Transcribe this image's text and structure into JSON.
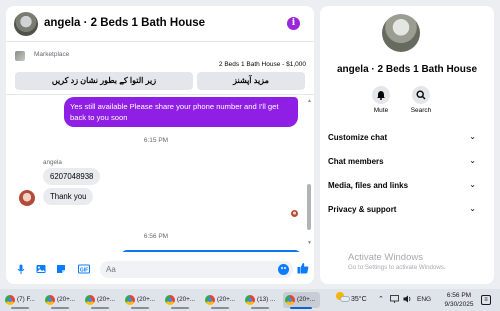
{
  "chat": {
    "title": "angela · 2 Beds 1 Bath House",
    "marketplace_label": "Marketplace",
    "listing": "2 Beds 1 Bath House - $1,000",
    "action_primary": "زیر التوا کے بطور نشان زد کریں",
    "action_secondary": "مزید آپشنز",
    "outgoing_message": "Yes still available Please share your phone number and I'll get back to you soon",
    "timestamp_1": "6:15 PM",
    "sender": "angela",
    "incoming_1": "6207048938",
    "incoming_2": "Thank you",
    "timestamp_2": "6:56 PM",
    "input_placeholder": "Aa"
  },
  "sidebar": {
    "title": "angela · 2 Beds 1 Bath House",
    "actions": [
      {
        "label": "Mute",
        "icon": "bell-icon"
      },
      {
        "label": "Search",
        "icon": "search-icon"
      }
    ],
    "sections": [
      "Customize chat",
      "Chat members",
      "Media, files and links",
      "Privacy & support"
    ],
    "watermark_title": "Activate Windows",
    "watermark_sub": "Go to Settings to activate Windows."
  },
  "taskbar": {
    "tasks": [
      "(7) F...",
      "(20+...",
      "(20+...",
      "(20+...",
      "(20+...",
      "(20+...",
      "(13) ...",
      "(20+..."
    ],
    "temperature": "35°C",
    "language": "ENG",
    "time": "6:56 PM",
    "date": "9/30/2025"
  },
  "colors": {
    "outgoing_bubble": "#8f1fe4",
    "accent_blue": "#0a7cff",
    "info_purple": "#9c27d8"
  }
}
